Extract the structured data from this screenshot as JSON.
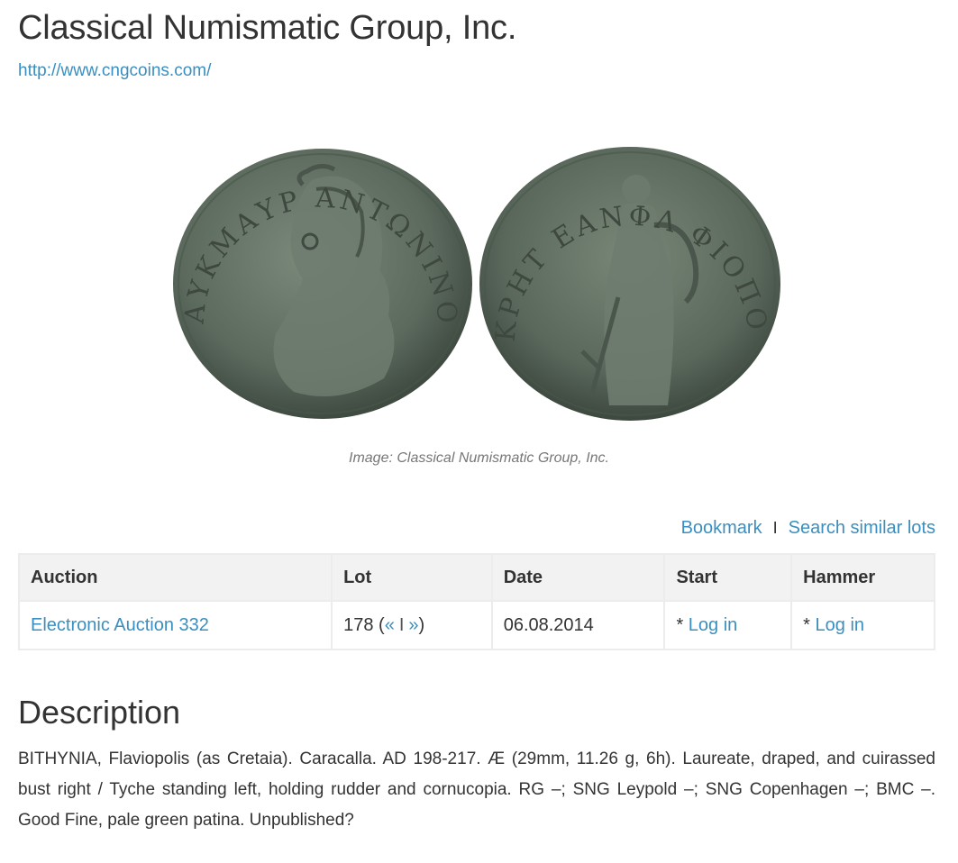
{
  "header": {
    "title": "Classical Numismatic Group, Inc.",
    "url": "http://www.cngcoins.com/"
  },
  "image": {
    "caption": "Image: Classical Numismatic Group, Inc.",
    "obverse_legend": "ΑΥΚΜΑΥΡ ΑΝΤΩΝΙΝΟ",
    "reverse_legend": "ΚΡΗΤ ΕΑΝΦΛ ΦΙΟΠΟΛΙΤΩΝ",
    "colors": {
      "coin_base": "#5c6a5e",
      "coin_dark": "#3f4a41",
      "coin_light": "#7b897b"
    }
  },
  "actions": {
    "bookmark": "Bookmark",
    "separator": "I",
    "search_similar": "Search similar lots"
  },
  "table": {
    "headers": [
      "Auction",
      "Lot",
      "Date",
      "Start",
      "Hammer"
    ],
    "row": {
      "auction": "Electronic Auction 332",
      "lot_number": "178 (",
      "prev": "«",
      "nav_sep": "I",
      "next": "»",
      "lot_close": ")",
      "date": "06.08.2014",
      "start_prefix": "* ",
      "start_link": "Log in",
      "hammer_prefix": "* ",
      "hammer_link": "Log in"
    }
  },
  "description": {
    "heading": "Description",
    "text": "BITHYNIA, Flaviopolis (as Cretaia). Caracalla. AD 198-217. Æ (29mm, 11.26 g, 6h). Laureate, draped, and cuirassed bust right / Tyche standing left, holding rudder and cornucopia. RG –; SNG Leypold –; SNG Copenhagen –; BMC –. Good Fine, pale green patina. Unpublished?"
  },
  "colors": {
    "link": "#3a8fc0",
    "header_bg": "#f2f2f2",
    "border": "#ececec"
  }
}
